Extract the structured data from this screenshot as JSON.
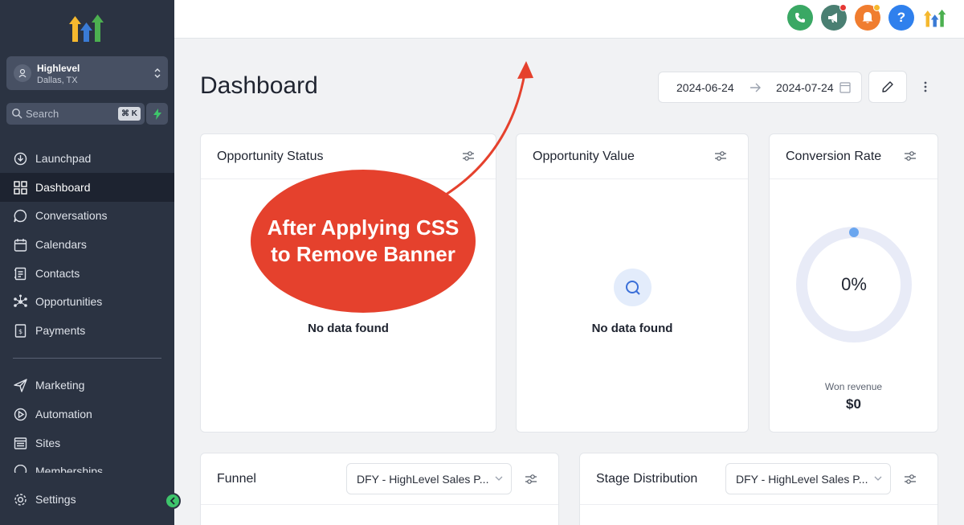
{
  "sidebar": {
    "account": {
      "name": "Highlevel",
      "location": "Dallas, TX"
    },
    "search": {
      "placeholder": "Search",
      "shortcut": "⌘ K"
    },
    "items": [
      {
        "label": "Launchpad",
        "icon": "rocket-icon"
      },
      {
        "label": "Dashboard",
        "icon": "grid-icon",
        "active": true
      },
      {
        "label": "Conversations",
        "icon": "chat-icon"
      },
      {
        "label": "Calendars",
        "icon": "calendar-icon"
      },
      {
        "label": "Contacts",
        "icon": "contacts-icon"
      },
      {
        "label": "Opportunities",
        "icon": "network-icon"
      },
      {
        "label": "Payments",
        "icon": "invoice-icon"
      }
    ],
    "items2": [
      {
        "label": "Marketing",
        "icon": "send-icon"
      },
      {
        "label": "Automation",
        "icon": "automation-icon"
      },
      {
        "label": "Sites",
        "icon": "sites-icon"
      },
      {
        "label": "Memberships",
        "icon": "membership-icon"
      }
    ],
    "settings": "Settings"
  },
  "topbar": {
    "buttons": [
      {
        "name": "phone",
        "color": "#3aa864"
      },
      {
        "name": "announcement",
        "color": "#4a7f72",
        "badge": true
      },
      {
        "name": "notifications",
        "color": "#f07d2f",
        "badge": true
      },
      {
        "name": "help",
        "color": "#2f80ed"
      }
    ]
  },
  "page": {
    "title": "Dashboard",
    "date_start": "2024-06-24",
    "date_end": "2024-07-24"
  },
  "cards": {
    "opportunity_status": {
      "title": "Opportunity Status",
      "empty": "No data found"
    },
    "opportunity_value": {
      "title": "Opportunity Value",
      "empty": "No data found"
    },
    "conversion_rate": {
      "title": "Conversion Rate",
      "value": "0%",
      "won_label": "Won revenue",
      "won_value": "$0"
    },
    "funnel": {
      "title": "Funnel",
      "select": "DFY - HighLevel Sales P..."
    },
    "stage_distribution": {
      "title": "Stage Distribution",
      "select": "DFY - HighLevel Sales P..."
    }
  },
  "annotation": {
    "line1": "After Applying CSS",
    "line2": "to Remove Banner"
  }
}
